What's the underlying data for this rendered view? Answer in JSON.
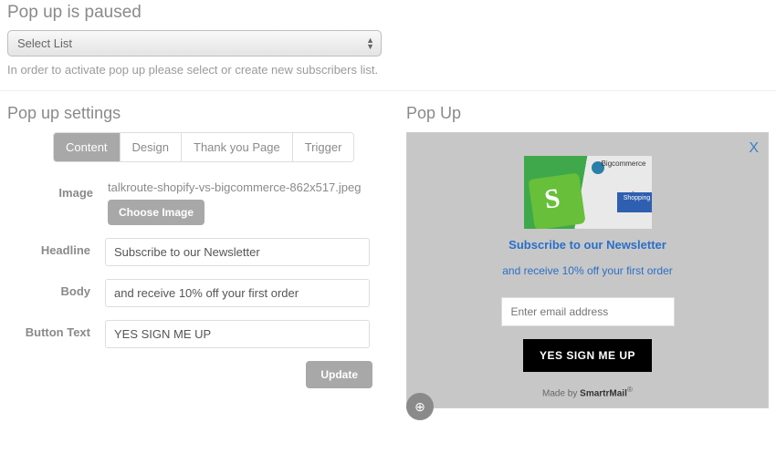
{
  "top": {
    "title": "Pop up is paused",
    "select_placeholder": "Select List",
    "helper": "In order to activate pop up please select or create new subscribers list."
  },
  "settings": {
    "title": "Pop up settings",
    "tabs": [
      "Content",
      "Design",
      "Thank you Page",
      "Trigger"
    ],
    "active_tab_index": 0,
    "labels": {
      "image": "Image",
      "headline": "Headline",
      "body": "Body",
      "button_text": "Button Text"
    },
    "image_filename": "talkroute-shopify-vs-bigcommerce-862x517.jpeg",
    "choose_image_btn": "Choose Image",
    "headline_value": "Subscribe to our Newsletter",
    "body_value": "and receive 10% off your first order",
    "button_text_value": "YES SIGN ME UP",
    "update_btn": "Update"
  },
  "preview": {
    "title": "Pop Up",
    "close_label": "X",
    "image_bc_text": "Bigcommerce",
    "image_box_text": "Shopping",
    "headline": "Subscribe to our Newsletter",
    "body": "and receive 10% off your first order",
    "email_placeholder": "Enter email address",
    "cta": "YES SIGN ME UP",
    "made_by_prefix": "Made by ",
    "made_by_brand": "SmartrMail",
    "zoom_icon": "⊕"
  }
}
